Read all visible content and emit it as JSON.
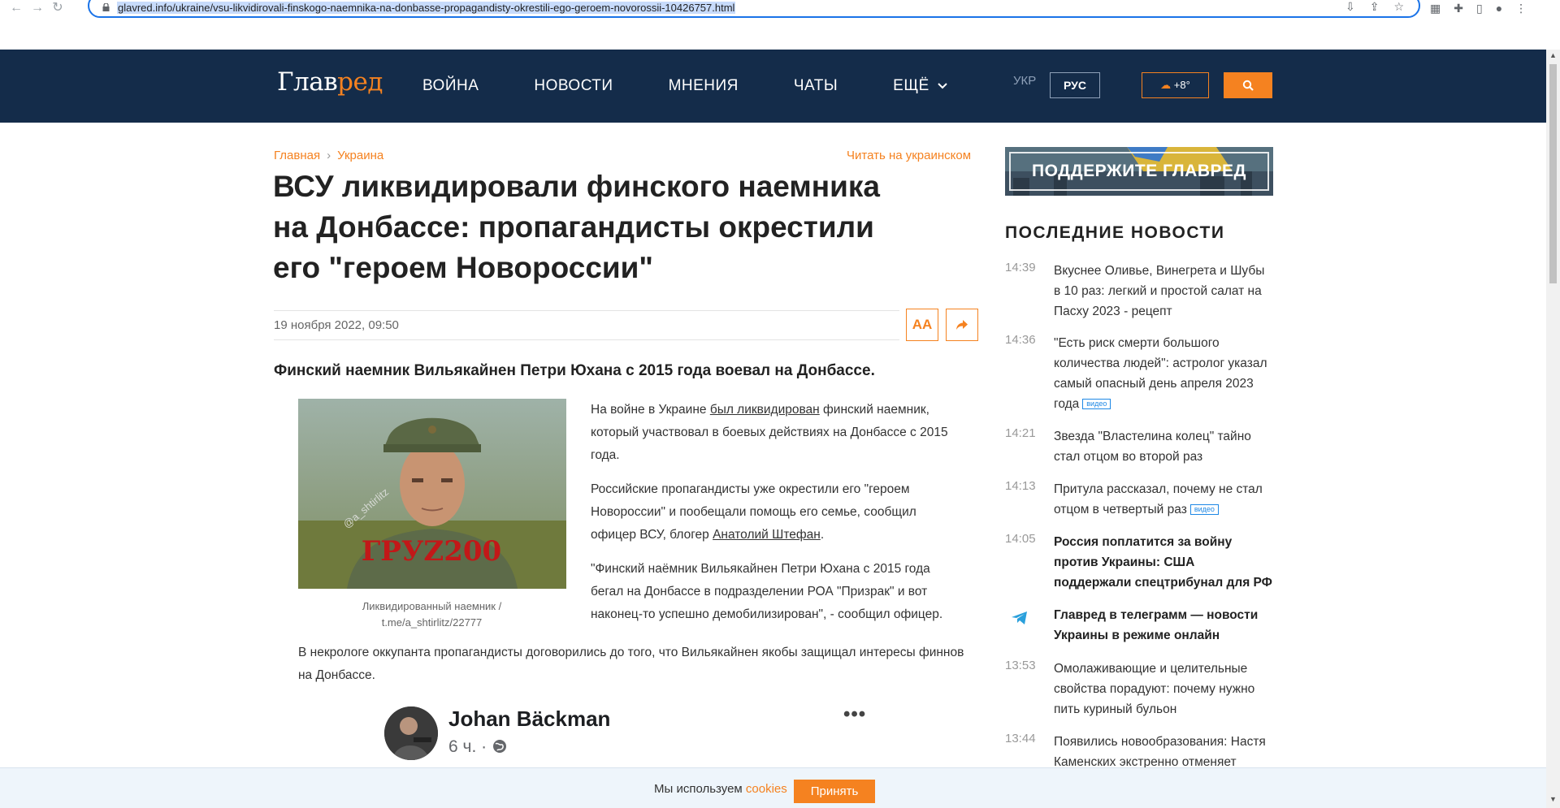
{
  "browser": {
    "url": "glavred.info/ukraine/vsu-likvidirovali-finskogo-naemnika-na-donbasse-propagandisty-okrestili-ego-geroem-novorossii-10426757.html"
  },
  "header": {
    "logo_main": "Глав",
    "logo_accent": "ред",
    "nav": [
      "ВОЙНА",
      "НОВОСТИ",
      "МНЕНИЯ",
      "ЧАТЫ"
    ],
    "nav_more": "ЕЩЁ",
    "lang_ukr": "УКР",
    "lang_rus": "РУС",
    "weather": "+8°"
  },
  "article": {
    "breadcrumb_home": "Главная",
    "breadcrumb_section": "Украина",
    "read_ua": "Читать на украинском",
    "title": "ВСУ ликвидировали финского наемника на Донбассе: пропагандисты окрестили его \"героем Новороссии\"",
    "date": "19 ноября 2022, 09:50",
    "font_btn": "AA",
    "lead": "Финский наемник Вильякайнен Петри Юхана с 2015 года воевал на Донбассе.",
    "photo_overlay": "ГРУZ200",
    "photo_watermark": "@a_shtirlitz",
    "caption": "Ликвидированный наемник / t.me/a_shtirlitz/22777",
    "p1_before": "На войне в Украине ",
    "p1_link": "был ликвидирован",
    "p1_after": " финский наемник, который участвовал в боевых действиях на Донбассе с 2015 года.",
    "p2_before": "Российские пропагандисты уже окрестили его \"героем Новороссии\" и пообещали помощь его семье, сообщил офицер ВСУ, блогер ",
    "p2_link": "Анатолий Штефан",
    "p2_after": ".",
    "p3": "\"Финский наёмник Вильякайнен Петри Юхана с 2015 года бегал на Донбассе в подразделении РОА \"Призрак\" и вот наконец-то успешно демобилизирован\", - сообщил офицер.",
    "p4": "В некрологе оккупанта пропагандисты договорились до того, что Вильякайнен якобы защищал интересы финнов на Донбассе."
  },
  "fb_post": {
    "author": "Johan Bäckman",
    "time": "6 ч. ·"
  },
  "sidebar": {
    "support": "ПОДДЕРЖИТЕ ГЛАВРЕД",
    "latest_title": "ПОСЛЕДНИЕ НОВОСТИ",
    "video_tag": "видео",
    "news": [
      {
        "time": "14:39",
        "text": "Вкуснее Оливье, Винегрета и Шубы в 10 раз: легкий и простой салат на Пасху 2023 - рецепт"
      },
      {
        "time": "14:36",
        "text": "\"Есть риск смерти большого количества людей\": астролог указал самый опасный день апреля 2023 года"
      },
      {
        "time": "14:21",
        "text": "Звезда \"Властелина колец\" тайно стал отцом во второй раз"
      },
      {
        "time": "14:13",
        "text": "Притула рассказал, почему не стал отцом в четвертый раз"
      },
      {
        "time": "14:05",
        "text": "Россия поплатится за войну против Украины: США поддержали спецтрибунал для РФ"
      },
      {
        "time": "",
        "text": "Главред в телеграмм — новости Украины в режиме онлайн"
      },
      {
        "time": "13:53",
        "text": "Омолаживающие и целительные свойства порадуют: почему нужно пить куриный бульон"
      },
      {
        "time": "13:44",
        "text": "Появились новообразования: Настя Каменских экстренно отменяет"
      }
    ]
  },
  "cookie": {
    "text": "Мы используем ",
    "link": "cookies",
    "accept": "Принять"
  },
  "colors": {
    "header_bg": "#142c4a",
    "accent": "#f58220",
    "video_tag": "#1e88e5"
  }
}
